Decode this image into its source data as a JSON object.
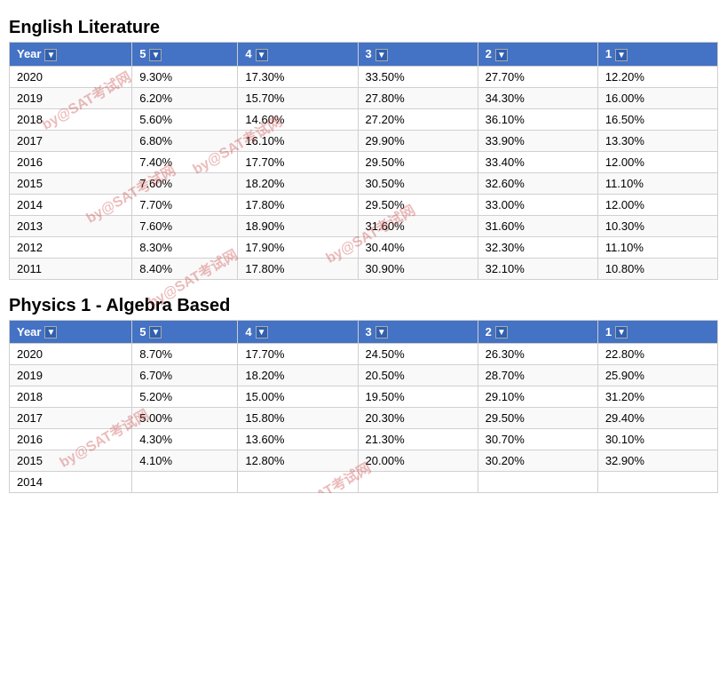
{
  "english_literature": {
    "title": "English Literature",
    "headers": [
      "Year",
      "5",
      "4",
      "3",
      "2",
      "1"
    ],
    "rows": [
      [
        "2020",
        "9.30%",
        "17.30%",
        "33.50%",
        "27.70%",
        "12.20%"
      ],
      [
        "2019",
        "6.20%",
        "15.70%",
        "27.80%",
        "34.30%",
        "16.00%"
      ],
      [
        "2018",
        "5.60%",
        "14.60%",
        "27.20%",
        "36.10%",
        "16.50%"
      ],
      [
        "2017",
        "6.80%",
        "16.10%",
        "29.90%",
        "33.90%",
        "13.30%"
      ],
      [
        "2016",
        "7.40%",
        "17.70%",
        "29.50%",
        "33.40%",
        "12.00%"
      ],
      [
        "2015",
        "7.60%",
        "18.20%",
        "30.50%",
        "32.60%",
        "11.10%"
      ],
      [
        "2014",
        "7.70%",
        "17.80%",
        "29.50%",
        "33.00%",
        "12.00%"
      ],
      [
        "2013",
        "7.60%",
        "18.90%",
        "31.60%",
        "31.60%",
        "10.30%"
      ],
      [
        "2012",
        "8.30%",
        "17.90%",
        "30.40%",
        "32.30%",
        "11.10%"
      ],
      [
        "2011",
        "8.40%",
        "17.80%",
        "30.90%",
        "32.10%",
        "10.80%"
      ]
    ]
  },
  "physics": {
    "title": "Physics 1 - Algebra Based",
    "headers": [
      "Year",
      "5",
      "4",
      "3",
      "2",
      "1"
    ],
    "rows": [
      [
        "2020",
        "8.70%",
        "17.70%",
        "24.50%",
        "26.30%",
        "22.80%"
      ],
      [
        "2019",
        "6.70%",
        "18.20%",
        "20.50%",
        "28.70%",
        "25.90%"
      ],
      [
        "2018",
        "5.20%",
        "15.00%",
        "19.50%",
        "29.10%",
        "31.20%"
      ],
      [
        "2017",
        "5.00%",
        "15.80%",
        "20.30%",
        "29.50%",
        "29.40%"
      ],
      [
        "2016",
        "4.30%",
        "13.60%",
        "21.30%",
        "30.70%",
        "30.10%"
      ],
      [
        "2015",
        "4.10%",
        "12.80%",
        "20.00%",
        "30.20%",
        "32.90%"
      ],
      [
        "2014",
        "",
        "",
        "",
        "",
        ""
      ]
    ]
  },
  "watermark": {
    "texts": [
      "by@SAT考试网",
      "by@SAT考试网",
      "by@SAT考试网",
      "by@SAT考试网",
      "by@SAT考试网",
      "by@SAT考试网"
    ]
  }
}
